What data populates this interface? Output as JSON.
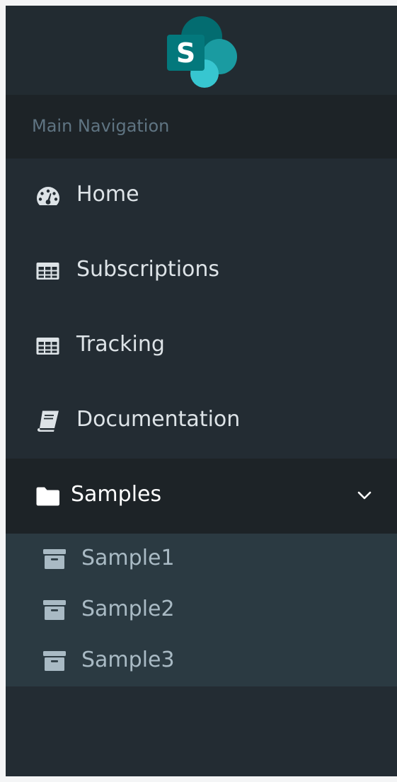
{
  "brand": {
    "logo_icon": "sharepoint-logo-icon",
    "logo_letter": "S",
    "colors": {
      "dark": "#036c70",
      "mid": "#1a9ba1",
      "light": "#37c6d0"
    }
  },
  "section": {
    "header": "Main Navigation"
  },
  "nav": {
    "items": [
      {
        "label": "Home",
        "icon": "tachometer-icon"
      },
      {
        "label": "Subscriptions",
        "icon": "table-icon"
      },
      {
        "label": "Tracking",
        "icon": "table-icon"
      },
      {
        "label": "Documentation",
        "icon": "book-icon"
      },
      {
        "label": "Samples",
        "icon": "folder-icon",
        "expanded": true,
        "toggle_icon": "chevron-down-icon"
      }
    ]
  },
  "submenu": {
    "items": [
      {
        "label": "Sample1",
        "icon": "archive-icon"
      },
      {
        "label": "Sample2",
        "icon": "archive-icon"
      },
      {
        "label": "Sample3",
        "icon": "archive-icon"
      }
    ]
  },
  "colors": {
    "sidebar_bg": "#232c33",
    "header_bg": "#1d2327",
    "submenu_bg": "#2b3a42",
    "text": "#dde3e7",
    "submenu_text": "#a9bac4",
    "section_text": "#5f7482"
  }
}
